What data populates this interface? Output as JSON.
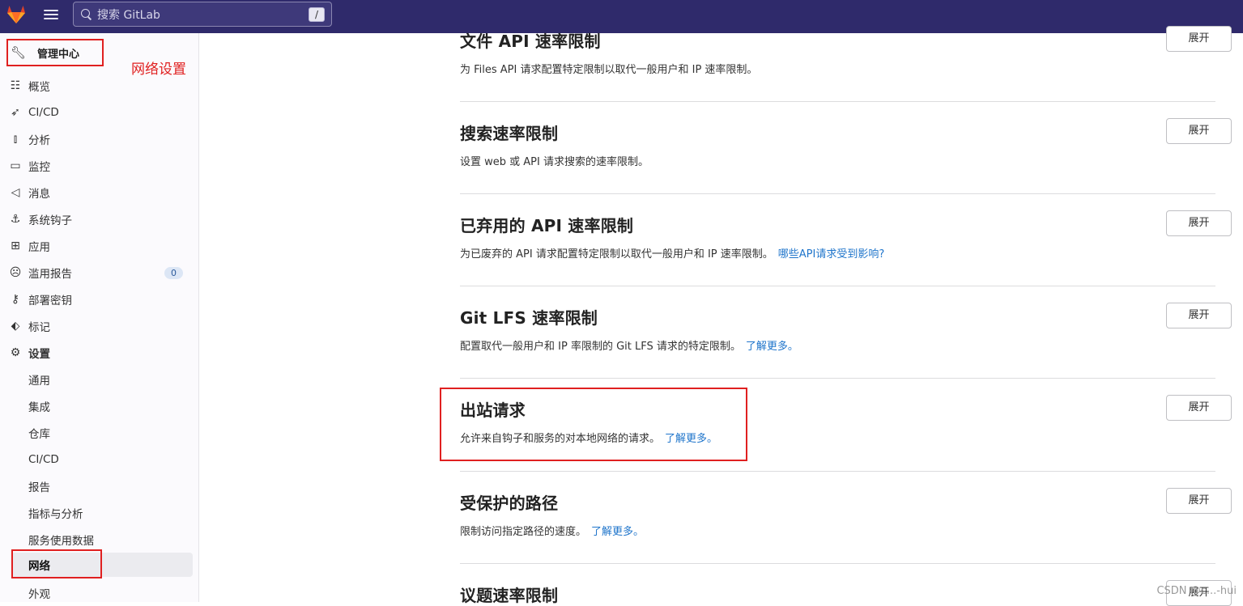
{
  "topbar": {
    "search_placeholder": "搜索 GitLab",
    "search_shortcut": "/"
  },
  "sidebar": {
    "header": "管理中心",
    "annotation": "网络设置",
    "items": [
      {
        "label": "概览",
        "icon": "overview-icon"
      },
      {
        "label": "CI/CD",
        "icon": "rocket-icon"
      },
      {
        "label": "分析",
        "icon": "chart-icon"
      },
      {
        "label": "监控",
        "icon": "monitor-icon"
      },
      {
        "label": "消息",
        "icon": "megaphone-icon"
      },
      {
        "label": "系统钩子",
        "icon": "anchor-icon"
      },
      {
        "label": "应用",
        "icon": "apps-icon"
      },
      {
        "label": "滥用报告",
        "icon": "face-icon",
        "badge": "0"
      },
      {
        "label": "部署密钥",
        "icon": "key-icon"
      },
      {
        "label": "标记",
        "icon": "tag-icon"
      },
      {
        "label": "设置",
        "icon": "gear-icon"
      }
    ],
    "sub_items": [
      {
        "label": "通用"
      },
      {
        "label": "集成"
      },
      {
        "label": "仓库"
      },
      {
        "label": "CI/CD"
      },
      {
        "label": "报告"
      },
      {
        "label": "指标与分析"
      },
      {
        "label": "服务使用数据"
      },
      {
        "label": "网络"
      },
      {
        "label": "外观"
      }
    ]
  },
  "sections": [
    {
      "title": "文件 API 速率限制",
      "desc": "为 Files API 请求配置特定限制以取代一般用户和 IP 速率限制。",
      "link": "",
      "button": "展开"
    },
    {
      "title": "搜索速率限制",
      "desc": "设置 web 或 API 请求搜索的速率限制。",
      "link": "",
      "button": "展开"
    },
    {
      "title": "已弃用的 API 速率限制",
      "desc": "为已废弃的 API 请求配置特定限制以取代一般用户和 IP 速率限制。",
      "link": "哪些API请求受到影响?",
      "button": "展开"
    },
    {
      "title": "Git LFS 速率限制",
      "desc": "配置取代一般用户和 IP 率限制的 Git LFS 请求的特定限制。",
      "link": "了解更多。",
      "button": "展开"
    },
    {
      "title": "出站请求",
      "desc": "允许来自钩子和服务的对本地网络的请求。",
      "link": "了解更多。",
      "button": "展开"
    },
    {
      "title": "受保护的路径",
      "desc": "限制访问指定路径的速度。",
      "link": "了解更多。",
      "button": "展开"
    },
    {
      "title": "议题速率限制",
      "desc": "",
      "link": "",
      "button": "展开"
    }
  ],
  "watermark": "CSDN @c...-hui",
  "colors": {
    "topbar": "#2f2a6b",
    "link": "#1f75cb",
    "annotation": "#e02020"
  }
}
